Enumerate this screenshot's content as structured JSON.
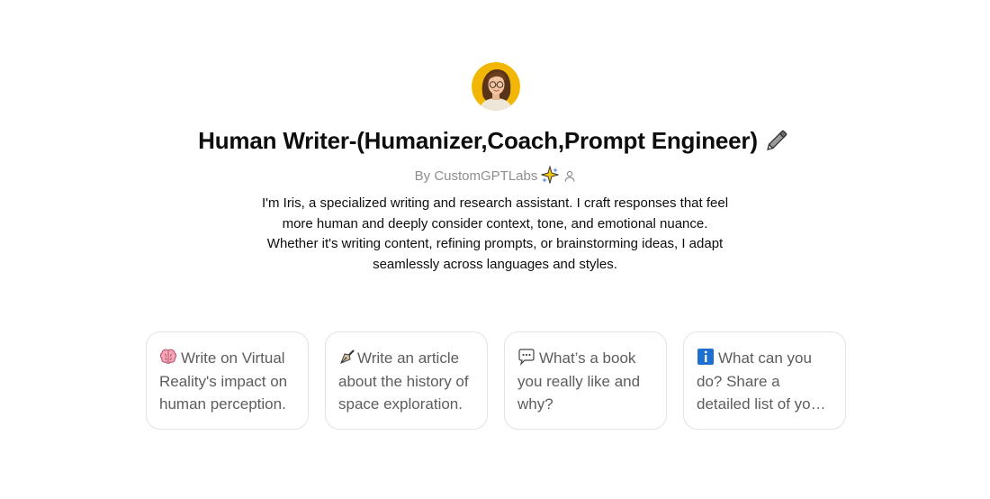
{
  "gpt": {
    "title": "Human Writer-(Humanizer,Coach,Prompt Engineer)",
    "title_icon": "pencil-icon",
    "byline": "By CustomGPTLabs",
    "byline_icon": "sparkle-icon",
    "author_icon": "person-icon",
    "description": "I'm Iris, a specialized writing and research assistant. I craft responses that feel more human and deeply consider context, tone, and emotional nuance. Whether it's writing content, refining prompts, or brainstorming ideas, I adapt seamlessly across languages and styles."
  },
  "starters": [
    {
      "icon": "brain-icon",
      "label": "Write on Virtual Reality's impact on human perception."
    },
    {
      "icon": "fountain-pen-icon",
      "label": "Write an article about the history of space exploration."
    },
    {
      "icon": "speech-bubble-icon",
      "label": "What’s a book you really like and why?"
    },
    {
      "icon": "information-icon",
      "label": "What can you do? Share a detailed list of your capabilities."
    }
  ],
  "colors": {
    "avatar_bg": "#f2b705",
    "text": "#0d0d0d",
    "muted": "#8e8e8e",
    "card_border": "#e3e3e3",
    "card_text": "#5d5d5d"
  }
}
